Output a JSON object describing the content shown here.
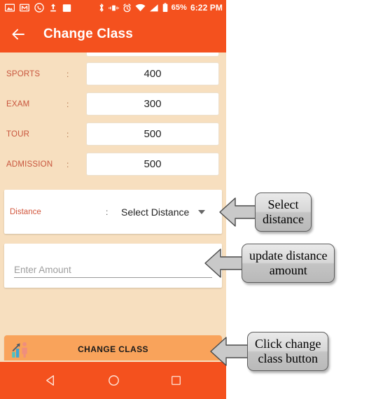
{
  "status_bar": {
    "icons": [
      "photo-icon",
      "gmail-icon",
      "whatsapp-icon",
      "upload-icon",
      "app-square-icon",
      "bluetooth-icon",
      "vibrate-icon",
      "alarm-icon",
      "wifi-icon",
      "signal-icon",
      "battery-icon"
    ],
    "battery_percent": "65%",
    "time": "6:22 PM"
  },
  "app_bar": {
    "back_icon": "back-arrow-icon",
    "title": "Change Class"
  },
  "fees": {
    "rows": [
      {
        "label": "SPORTS",
        "colon": ":",
        "value": "400"
      },
      {
        "label": "EXAM",
        "colon": ":",
        "value": "300"
      },
      {
        "label": "TOUR",
        "colon": ":",
        "value": "500"
      },
      {
        "label": "ADMISSION",
        "colon": ":",
        "value": "500"
      }
    ]
  },
  "distance": {
    "label": "Distance",
    "colon": ":",
    "selected": "Select Distance",
    "caret_icon": "chevron-down-icon"
  },
  "amount": {
    "placeholder": "Enter Amount",
    "value": ""
  },
  "change_class_button": {
    "icon": "growth-chart-person-icon",
    "label": "CHANGE CLASS"
  },
  "nav_bar": {
    "back": "nav-back-triangle-icon",
    "home": "nav-home-circle-icon",
    "recents": "nav-recents-square-icon"
  },
  "annotations": [
    {
      "id": "select-distance",
      "text_line1": "Select",
      "text_line2": "distance",
      "arrow_icon": "left-arrow-callout-icon"
    },
    {
      "id": "update-distance-amount",
      "text_line1": "update distance",
      "text_line2": "amount",
      "arrow_icon": "left-arrow-callout-icon"
    },
    {
      "id": "click-change-class",
      "text_line1": "Click change",
      "text_line2": "class button",
      "arrow_icon": "left-arrow-callout-icon"
    }
  ],
  "colors": {
    "primary_orange": "#f4511e",
    "background_peach": "#f7dfbf",
    "label_red": "#c8553d",
    "button_orange": "#f9a35b"
  }
}
